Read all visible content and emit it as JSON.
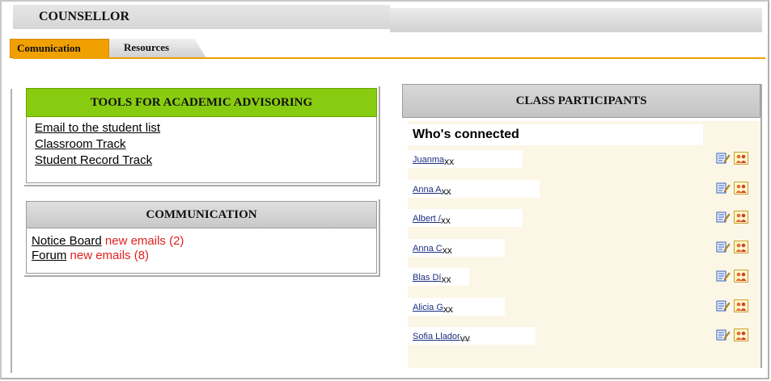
{
  "app_title": "COUNSELLOR",
  "tabs": [
    {
      "label": "Comunication",
      "active": true
    },
    {
      "label": "Resources",
      "active": false
    }
  ],
  "tools": {
    "title": "TOOLS FOR ACADEMIC ADVISORING",
    "links": [
      "Email to the student list",
      "Classroom Track",
      "Student Record Track"
    ],
    "header_color": "#88cc11"
  },
  "communication": {
    "title": "COMMUNICATION",
    "items": [
      {
        "label": "Notice Board",
        "status": "new emails (2)"
      },
      {
        "label": "Forum",
        "status": "new emails (8)"
      }
    ],
    "status_color": "#e02020"
  },
  "participants": {
    "title": "CLASS PARTICIPANTS",
    "subtitle": "Who's connected",
    "list": [
      {
        "name": "Juanma",
        "suffix": "xx"
      },
      {
        "name": "Anna A",
        "suffix": "xx"
      },
      {
        "name": "Albert /",
        "suffix": "xx"
      },
      {
        "name": "Anna C",
        "suffix": "xx"
      },
      {
        "name": "Blas Dí",
        "suffix": "xx"
      },
      {
        "name": "Alicia G",
        "suffix": "xx"
      },
      {
        "name": "Sofia Llador",
        "suffix": "vv"
      }
    ],
    "row_icons": [
      "edit-message-icon",
      "group-users-icon"
    ]
  },
  "accent_color": "#f0a000"
}
